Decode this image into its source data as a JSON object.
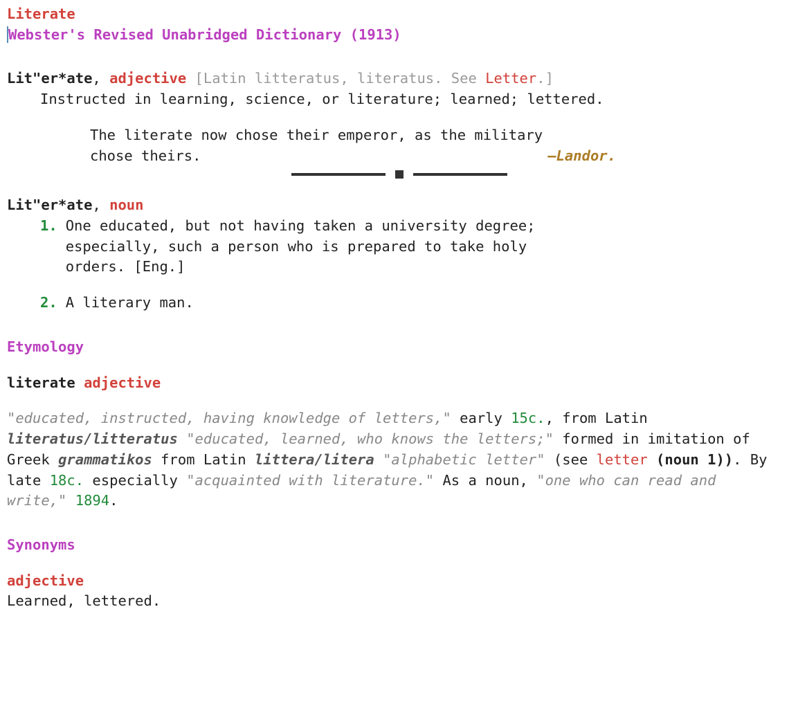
{
  "header": {
    "title": "Literate",
    "source": "Webster's Revised Unabridged Dictionary (1913)"
  },
  "entries": [
    {
      "headword": "Lit\"er*ate",
      "comma": ", ",
      "pos": "adjective",
      "etym_open": " [",
      "etym_text": "Latin litteratus, literatus. See ",
      "etym_link": "Letter",
      "etym_close": ".]",
      "definition": "Instructed in learning, science, or literature; learned; lettered.",
      "quote_l1": "The literate now chose their emperor, as the military",
      "quote_l2": "chose theirs.",
      "quote_attr_dash": "—",
      "quote_attr": "Landor."
    },
    {
      "headword": "Lit\"er*ate",
      "comma": ", ",
      "pos": "noun",
      "senses": [
        {
          "num": "1.",
          "text": "One educated, but not having taken a university degree; especially, such a person who is prepared to take holy orders. [Eng.]"
        },
        {
          "num": "2.",
          "text": "A literary man."
        }
      ]
    }
  ],
  "etymology": {
    "heading": "Etymology",
    "word": "literate",
    "pos": "adjective",
    "seg": {
      "q1": "\"educated, instructed, having knowledge of letters,\"",
      "t1": " early ",
      "d1": "15c.",
      "t2": ", from Latin ",
      "b1": "literatus",
      "slash1": "/",
      "b2": "litteratus",
      "sp1": " ",
      "q2": "\"educated, learned, who knows the letters;\"",
      "t3": " formed in imitation of Greek ",
      "b3": "grammatikos",
      "t4": " from Latin ",
      "b4": "littera",
      "slash2": "/",
      "b5": "litera",
      "sp2": " ",
      "q3": "\"alphabetic letter\"",
      "t5": " (see ",
      "link": "letter",
      "t6": " (noun 1))",
      "t7": ". By late ",
      "d2": "18c.",
      "t8": " especially ",
      "q4": "\"acquainted with literature.\"",
      "t9": " As a noun, ",
      "q5": "\"one who can read and write,\"",
      "sp3": " ",
      "d3": "1894",
      "t10": "."
    }
  },
  "synonyms": {
    "heading": "Synonyms",
    "pos": "adjective",
    "text": "Learned, lettered."
  }
}
